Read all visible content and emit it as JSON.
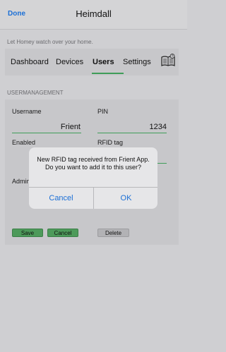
{
  "nav": {
    "done_label": "Done",
    "title": "Heimdall"
  },
  "subtitle": "Let Homey watch over your home.",
  "tabs": [
    {
      "label": "Dashboard"
    },
    {
      "label": "Devices"
    },
    {
      "label": "Users",
      "active": true
    },
    {
      "label": "Settings"
    }
  ],
  "section_label": "USERMANAGEMENT",
  "form": {
    "username_label": "Username",
    "username_value": "Frient",
    "pin_label": "PIN",
    "pin_value": "1234",
    "enabled_label": "Enabled",
    "rfid_label": "RFID tag",
    "admin_label": "Admin"
  },
  "buttons": {
    "save": "Save",
    "cancel": "Cancel",
    "delete": "Delete"
  },
  "dialog": {
    "message": "New RFID tag received from Frient App. Do you want to add it to this user?",
    "cancel": "Cancel",
    "ok": "OK"
  },
  "colors": {
    "accent": "#3f9d59",
    "link": "#1b6fd6"
  },
  "icons": {
    "help": "book-help-icon"
  }
}
